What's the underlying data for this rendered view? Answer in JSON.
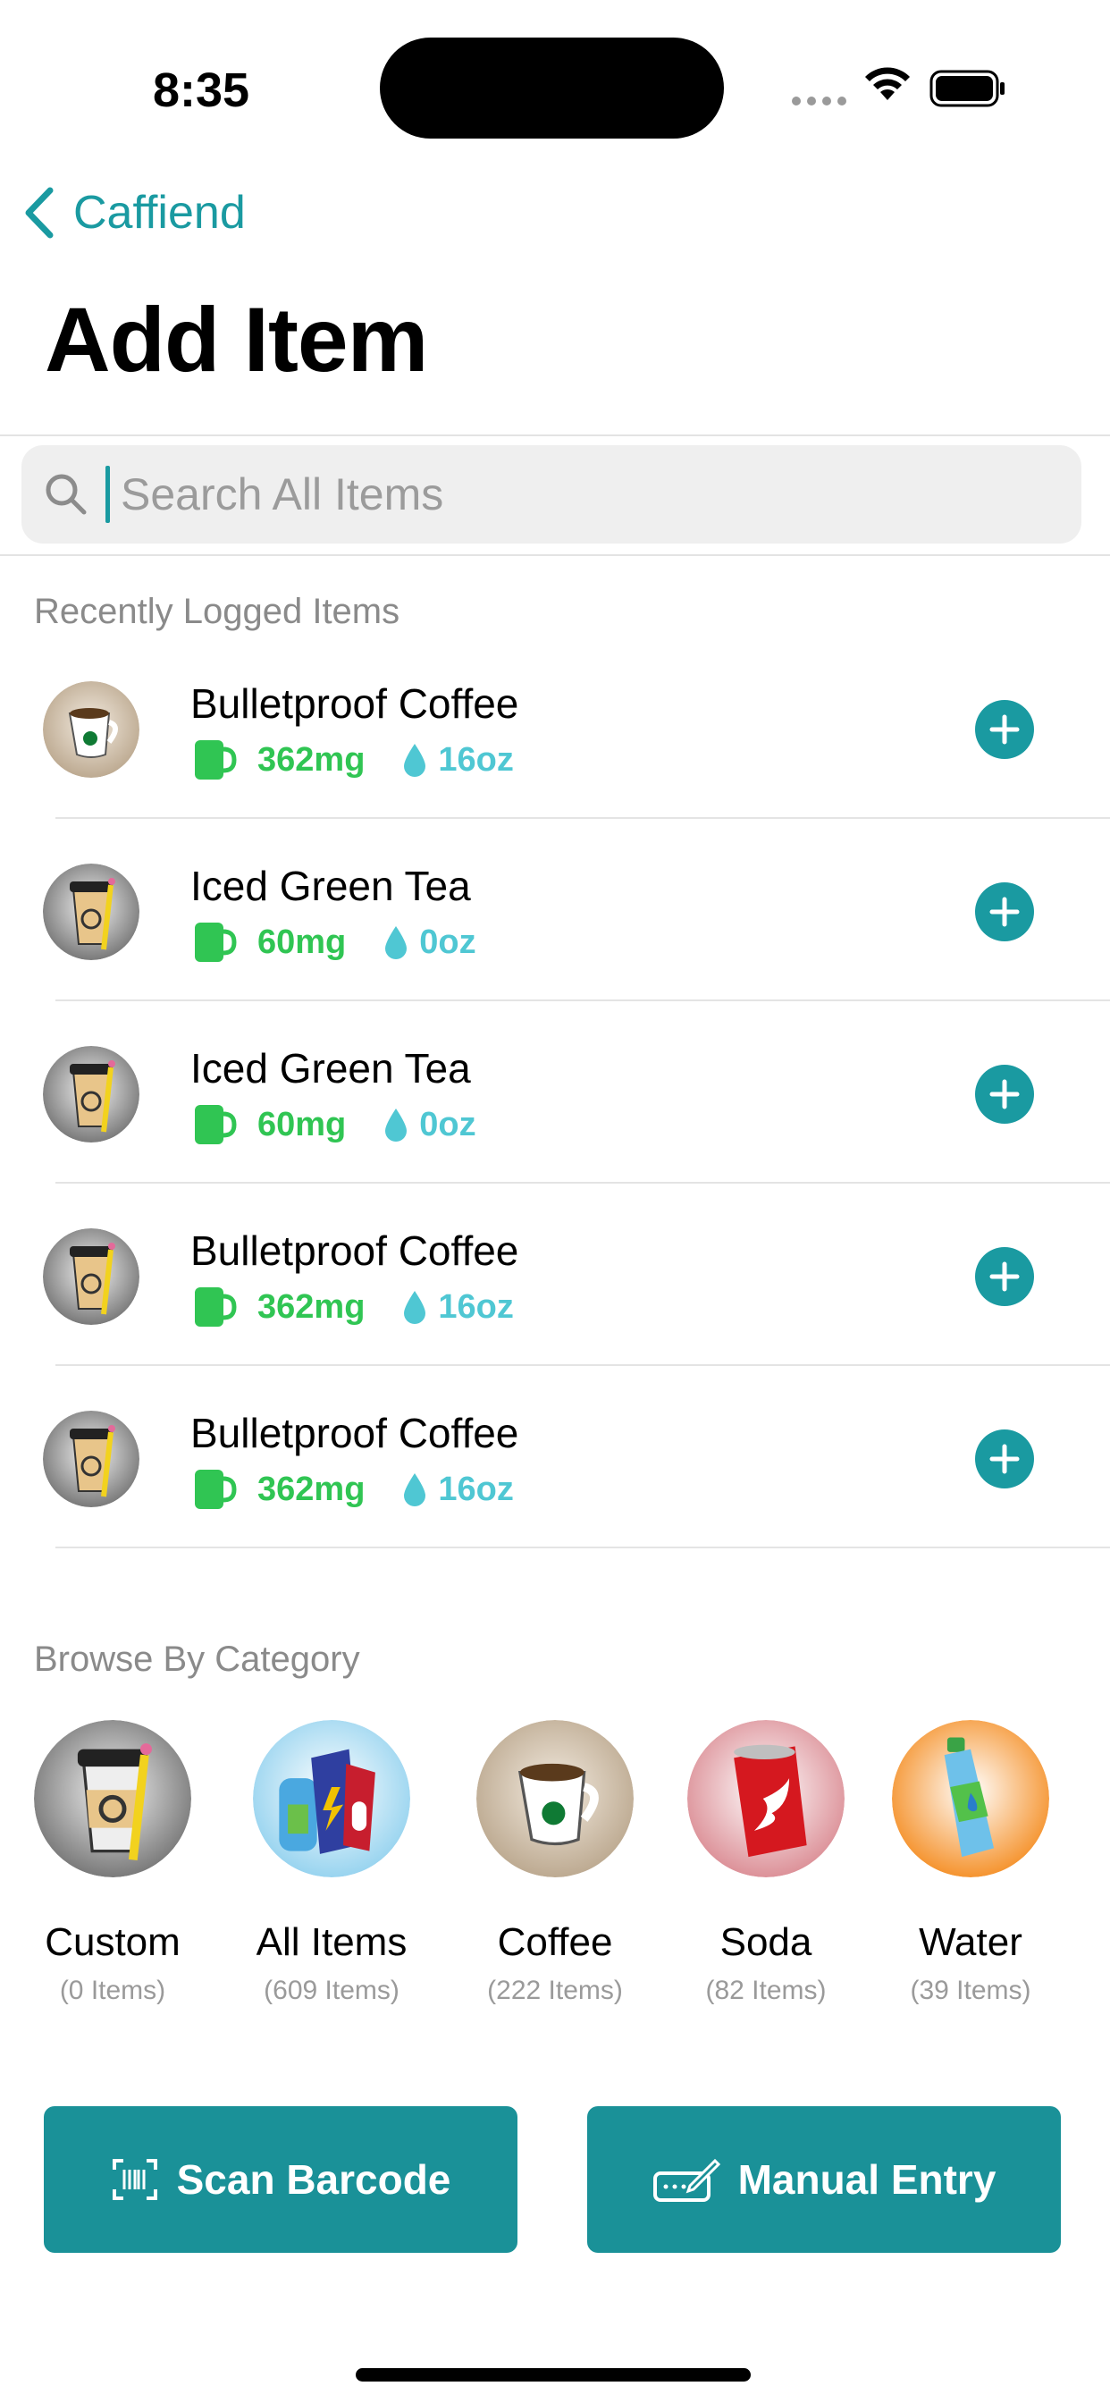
{
  "status_bar": {
    "time": "8:35"
  },
  "nav": {
    "back_label": "Caffiend",
    "title": "Add Item"
  },
  "search": {
    "placeholder": "Search All Items",
    "value": ""
  },
  "recent": {
    "heading": "Recently Logged Items",
    "items": [
      {
        "name": "Bulletproof Coffee",
        "caffeine": "362mg",
        "volume": "16oz",
        "icon": "coffee-mug-icon"
      },
      {
        "name": "Iced Green Tea",
        "caffeine": "60mg",
        "volume": "0oz",
        "icon": "custom-cup-icon"
      },
      {
        "name": "Iced Green Tea",
        "caffeine": "60mg",
        "volume": "0oz",
        "icon": "custom-cup-icon"
      },
      {
        "name": "Bulletproof Coffee",
        "caffeine": "362mg",
        "volume": "16oz",
        "icon": "custom-cup-icon"
      },
      {
        "name": "Bulletproof Coffee",
        "caffeine": "362mg",
        "volume": "16oz",
        "icon": "custom-cup-icon"
      }
    ]
  },
  "categories": {
    "heading": "Browse By Category",
    "items": [
      {
        "name": "Custom",
        "count": "(0 Items)",
        "icon": "custom-cup-icon"
      },
      {
        "name": "All Items",
        "count": "(609 Items)",
        "icon": "all-items-icon"
      },
      {
        "name": "Coffee",
        "count": "(222 Items)",
        "icon": "coffee-mug-icon"
      },
      {
        "name": "Soda",
        "count": "(82 Items)",
        "icon": "soda-can-icon"
      },
      {
        "name": "Water",
        "count": "(39 Items)",
        "icon": "water-bottle-icon"
      }
    ]
  },
  "actions": {
    "scan_label": "Scan Barcode",
    "manual_label": "Manual Entry"
  },
  "colors": {
    "accent": "#1a9aa1",
    "button": "#1a9198",
    "caffeine": "#30c553",
    "volume": "#4fc7d3"
  }
}
